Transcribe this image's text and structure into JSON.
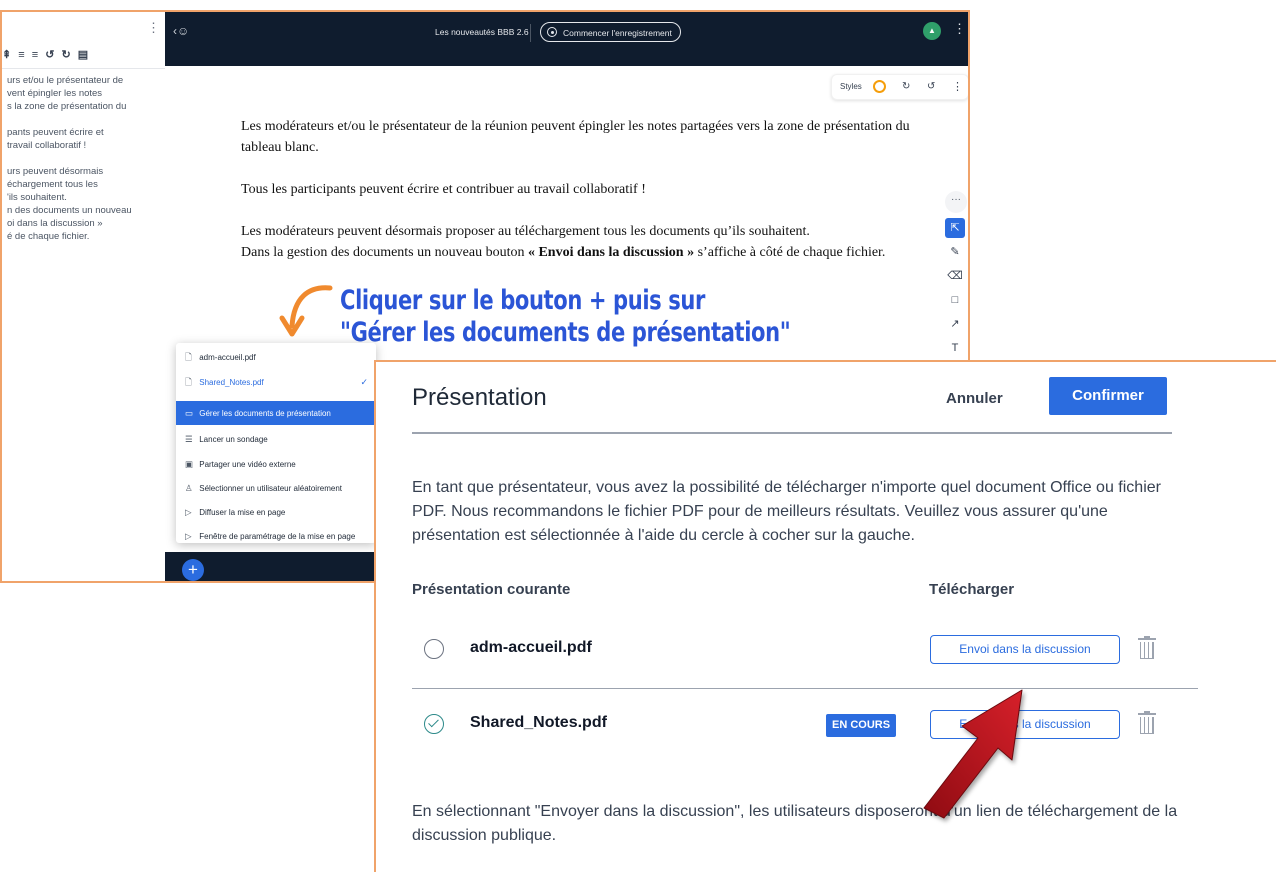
{
  "notes_panel": {
    "toolbar_icons": [
      "indent-icon",
      "list-icon",
      "list-ordered-icon",
      "undo-icon",
      "redo-icon",
      "export-icon"
    ],
    "toolbar_text": "⇞ ≡ ≡ ↺ ↻ ▤",
    "text": "urs et/ou le présentateur de\nvent épingler les notes\ns la zone de présentation du\n\npants peuvent écrire et\ntravail collaboratif !\n\nurs peuvent désormais\néchargement tous les\n'ils souhaitent.\nn des documents un nouveau\noi dans la discussion »\né de chaque fichier."
  },
  "topbar": {
    "title": "Les nouveautés BBB 2.6",
    "record_label": "Commencer l'enregistrement"
  },
  "whiteboard": {
    "styles_label": "Styles",
    "paragraph_1": "Les modérateurs et/ou le présentateur de la réunion peuvent épingler les notes partagées vers la zone de présentation du tableau blanc.",
    "paragraph_2": "Tous les participants peuvent écrire et contribuer au travail collaboratif !",
    "paragraph_3a": "Les modérateurs peuvent désormais proposer au téléchargement tous les documents qu’ils souhaitent.",
    "paragraph_3b_pre": "Dans la gestion des documents un nouveau bouton ",
    "paragraph_3b_bold": "« Envoi dans la discussion »",
    "paragraph_3b_post": " s’affiche à côté de chaque fichier.",
    "tools": [
      "more-icon",
      "select-icon",
      "pencil-icon",
      "eraser-icon",
      "rectangle-icon",
      "arrow-icon",
      "text-icon"
    ]
  },
  "annotation": {
    "line_1": "Cliquer sur le bouton + puis sur",
    "line_2": "\"Gérer les documents de présentation\""
  },
  "plus_menu": {
    "items": [
      {
        "label": "adm-accueil.pdf",
        "icon": "file-icon"
      },
      {
        "label": "Shared_Notes.pdf",
        "icon": "file-icon"
      },
      {
        "label": "Gérer les documents de présentation",
        "icon": "presentation-icon"
      },
      {
        "label": "Lancer un sondage",
        "icon": "poll-icon"
      },
      {
        "label": "Partager une vidéo externe",
        "icon": "video-icon"
      },
      {
        "label": "Sélectionner un utilisateur aléatoirement",
        "icon": "user-icon"
      },
      {
        "label": "Diffuser la mise en page",
        "icon": "broadcast-icon"
      },
      {
        "label": "Fenêtre de paramétrage de la mise en page",
        "icon": "broadcast-icon"
      }
    ]
  },
  "dialog": {
    "title": "Présentation",
    "cancel_label": "Annuler",
    "confirm_label": "Confirmer",
    "description": "En tant que présentateur, vous avez la possibilité de télécharger n'importe quel document Office ou fichier PDF. Nous recommandons le fichier PDF pour de meilleurs résultats. Veuillez vous assurer qu'une présentation est sélectionnée à l'aide du cercle à cocher sur la gauche.",
    "header_current": "Présentation courante",
    "header_download": "Télécharger",
    "files": [
      {
        "name": "adm-accueil.pdf",
        "selected": false,
        "send_label": "Envoi dans la discussion"
      },
      {
        "name": "Shared_Notes.pdf",
        "selected": true,
        "badge": "EN COURS",
        "send_label": "Envoi dans la discussion"
      }
    ],
    "note": "En sélectionnant \"Envoyer dans la discussion\", les utilisateurs disposeront d'un lien de téléchargement de la discussion publique."
  },
  "colors": {
    "accent_blue": "#2b6cdf",
    "annotation_blue": "#2b55d6",
    "annotation_orange": "#f08a2e",
    "frame_orange": "#f0a36a",
    "dark_bar": "#0f1c2e",
    "red_arrow": "#c0131c"
  }
}
